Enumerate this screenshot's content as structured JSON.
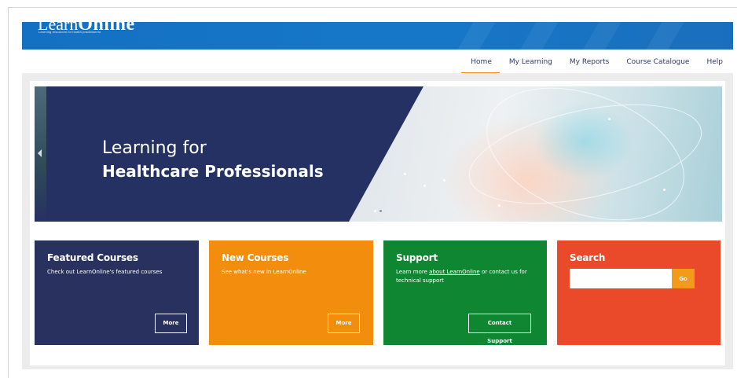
{
  "brand": {
    "logo_learn": "Learn",
    "logo_online": "Online",
    "tagline": "Learning resources for health practitioners",
    "color": "#1470c2"
  },
  "nav": {
    "items": [
      {
        "label": "Home",
        "active": true
      },
      {
        "label": "My Learning",
        "active": false
      },
      {
        "label": "My Reports",
        "active": false
      },
      {
        "label": "Course Catalogue",
        "active": false
      },
      {
        "label": "Help",
        "active": false
      }
    ],
    "active_color": "#f28c1b"
  },
  "hero": {
    "title_line1": "Learning for",
    "title_line2": "Healthcare Professionals",
    "background": "#263163",
    "prev_icon": "chevron-left-icon"
  },
  "tiles": {
    "featured": {
      "title": "Featured Courses",
      "description": "Check out LearnOnline's featured courses",
      "button_label": "More",
      "color": "#29315f"
    },
    "new_courses": {
      "title": "New Courses",
      "description": "See what's new in LearnOnline",
      "button_label": "More",
      "color": "#f28d0d"
    },
    "support": {
      "title": "Support",
      "description_prefix": "Learn more ",
      "description_link": "about LearnOnline",
      "description_suffix": " or contact us for technical support",
      "button_label": "Contact Support",
      "color": "#0e8632"
    },
    "search": {
      "title": "Search",
      "input_value": "",
      "input_placeholder": "",
      "button_label": "Go",
      "color": "#ea4a2a"
    }
  }
}
